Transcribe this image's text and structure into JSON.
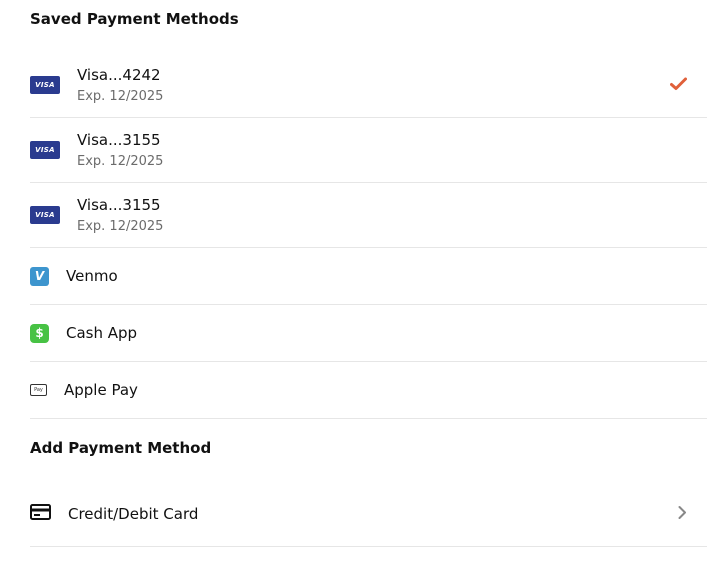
{
  "saved": {
    "title": "Saved Payment Methods",
    "cards": [
      {
        "label": "Visa...4242",
        "exp": "Exp. 12/2025",
        "brand": "VISA",
        "selected": true
      },
      {
        "label": "Visa...3155",
        "exp": "Exp. 12/2025",
        "brand": "VISA",
        "selected": false
      },
      {
        "label": "Visa...3155",
        "exp": "Exp. 12/2025",
        "brand": "VISA",
        "selected": false
      }
    ],
    "wallets": [
      {
        "label": "Venmo",
        "icon": "venmo-icon",
        "glyph": "V"
      },
      {
        "label": "Cash App",
        "icon": "cash-app-icon",
        "glyph": "$"
      },
      {
        "label": "Apple Pay",
        "icon": "apple-pay-icon",
        "glyph": "Pay"
      }
    ]
  },
  "add": {
    "title": "Add Payment Method",
    "items": [
      {
        "label": "Credit/Debit Card",
        "icon": "credit-card-icon"
      }
    ]
  },
  "colors": {
    "check": "#e0603a",
    "visa": "#2a3b8f",
    "venmo": "#3d95ce",
    "cashapp": "#47c244"
  }
}
